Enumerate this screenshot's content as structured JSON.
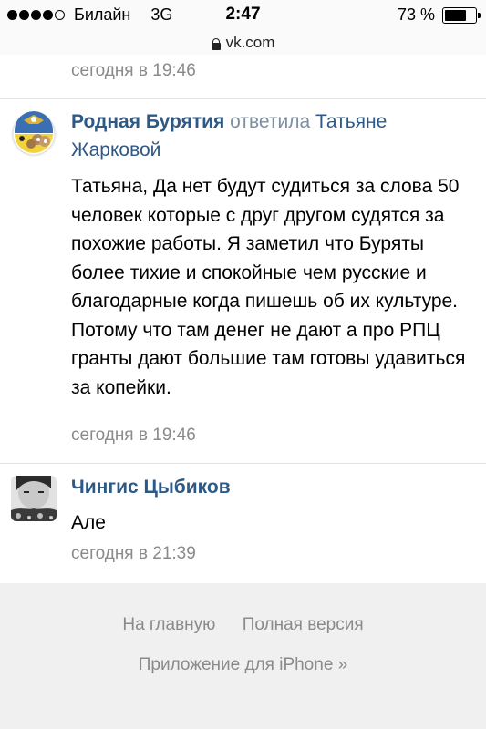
{
  "status_bar": {
    "carrier": "Билайн",
    "network": "3G",
    "time": "2:47",
    "battery_percent": "73 %",
    "battery_level": 0.73,
    "signal_bars_filled": 4,
    "signal_bars_total": 5
  },
  "url_bar": {
    "icon": "lock-icon",
    "url": "vk.com"
  },
  "previous_comment": {
    "date": "сегодня в 19:46"
  },
  "comments": [
    {
      "author": "Родная Бурятия",
      "action": "ответила",
      "reply_to": "Татьяне Жарковой",
      "text": "Татьяна, Да нет будут судиться за слова 50 человек которые с друг другом судятся за похожие работы. Я заметил что Буряты более тихие и спокойные чем русские и благодарные когда пишешь об их культуре. Потому что там денег не дают а про РПЦ гранты дают большие там готовы удавиться за копейки.",
      "date": "сегодня в 19:46"
    },
    {
      "author": "Чингис Цыбиков",
      "text": "Але",
      "date": "сегодня в 21:39"
    }
  ],
  "footer": {
    "home_link": "На главную",
    "full_version_link": "Полная версия",
    "app_link": "Приложение для iPhone »"
  },
  "colors": {
    "link": "#2f5985",
    "muted": "#8a8a8a",
    "footer_bg": "#f0f0f0"
  }
}
